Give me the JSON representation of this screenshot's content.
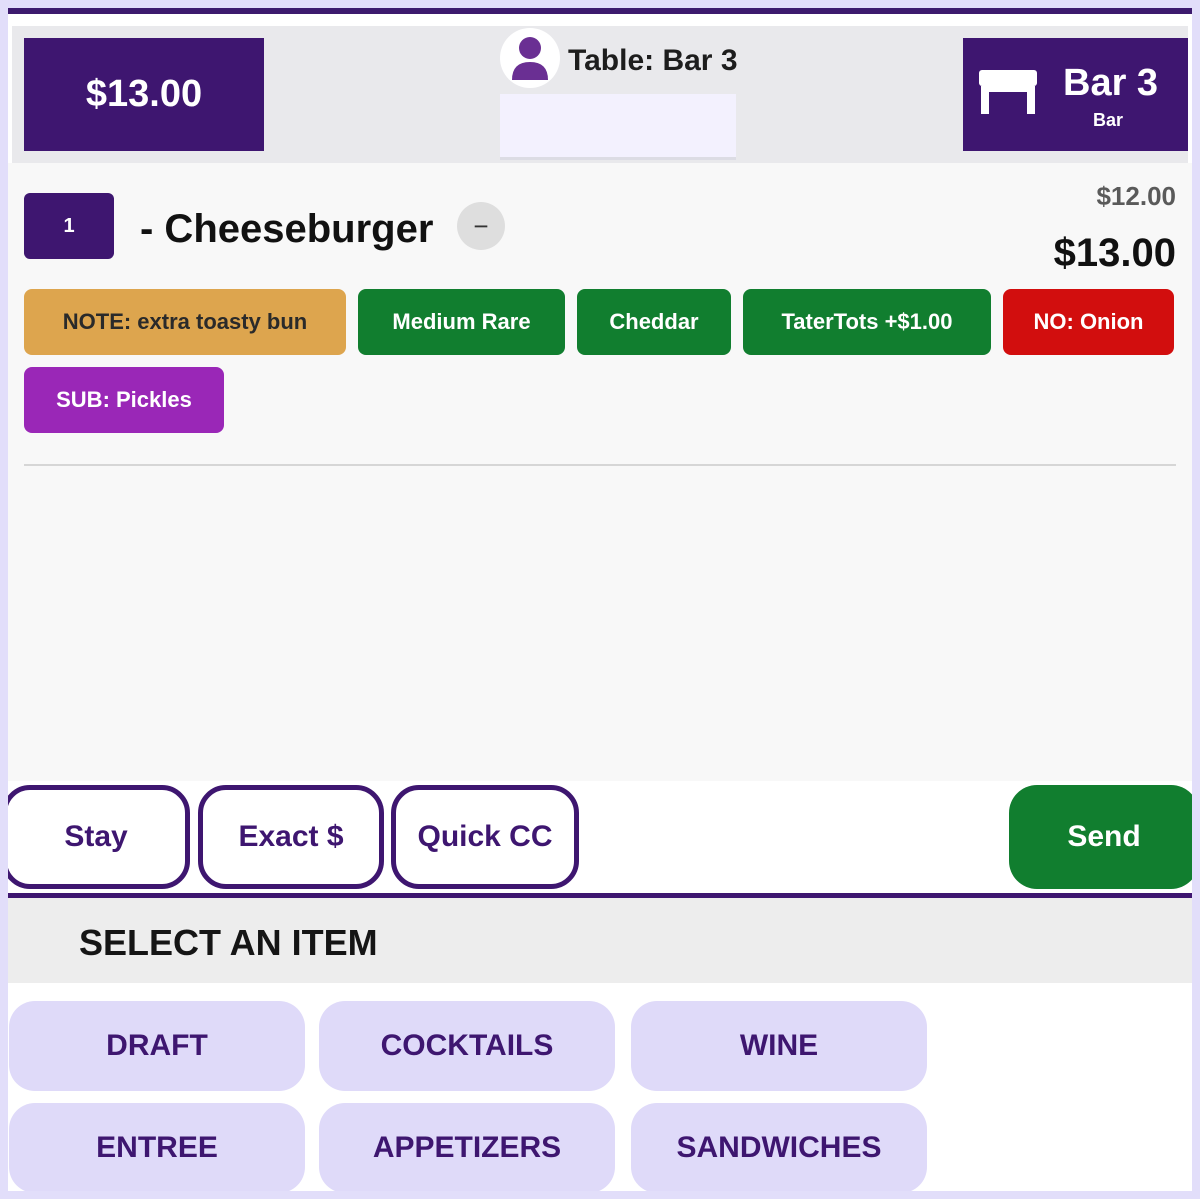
{
  "header": {
    "order_total": "$13.00",
    "table_label": "Table: Bar 3",
    "guest_placeholder": "",
    "station": {
      "name": "Bar 3",
      "type": "Bar"
    }
  },
  "order": {
    "items": [
      {
        "quantity": "1",
        "name": "- Cheeseburger",
        "base_price": "$12.00",
        "line_total": "$13.00",
        "modifiers": [
          {
            "label": "NOTE: extra toasty bun",
            "kind": "note",
            "color": "#dda54e"
          },
          {
            "label": "Medium Rare",
            "kind": "add",
            "color": "#117e2f"
          },
          {
            "label": "Cheddar",
            "kind": "add",
            "color": "#117e2f"
          },
          {
            "label": "TaterTots +$1.00",
            "kind": "add",
            "color": "#117e2f"
          },
          {
            "label": "NO: Onion",
            "kind": "no",
            "color": "#d20e0e"
          },
          {
            "label": "SUB: Pickles",
            "kind": "sub",
            "color": "#9a27b7"
          }
        ]
      }
    ]
  },
  "actions": {
    "stay": "Stay",
    "exact": "Exact $",
    "quick_cc": "Quick CC",
    "send": "Send"
  },
  "menu": {
    "title": "SELECT AN ITEM",
    "categories": [
      "DRAFT",
      "COCKTAILS",
      "WINE",
      "ENTREE",
      "APPETIZERS",
      "SANDWICHES"
    ]
  },
  "icons": {
    "avatar": "user-icon",
    "station": "table-icon",
    "remove": "minus-icon"
  },
  "colors": {
    "brand": "#3e1670",
    "accent_green": "#117e2f",
    "category_bg": "#dfdaf9"
  }
}
